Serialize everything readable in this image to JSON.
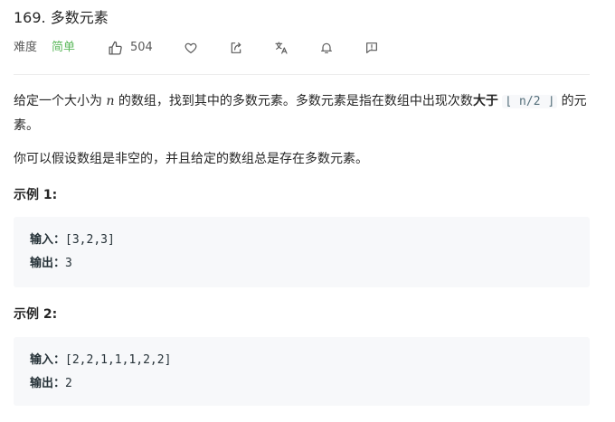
{
  "problem": {
    "title": "169. 多数元素",
    "difficulty_label": "难度",
    "difficulty_value": "简单",
    "likes": "504"
  },
  "toolbar": {
    "icons": [
      "thumbs-up-icon",
      "heart-icon",
      "share-icon",
      "translate-icon",
      "bell-icon",
      "feedback-icon"
    ]
  },
  "description": {
    "p1_part1": "给定一个大小为 ",
    "p1_var": "n",
    "p1_part2": " 的数组，找到其中的多数元素。多数元素是指在数组中出现次数",
    "p1_bold": "大于",
    "p1_code": "⌊ n/2 ⌋",
    "p1_part3": " 的元素。",
    "p2": "你可以假设数组是非空的，并且给定的数组总是存在多数元素。"
  },
  "examples": [
    {
      "heading": "示例 1:",
      "input_label": "输入：",
      "input_value": "[3,2,3]",
      "output_label": "输出：",
      "output_value": "3"
    },
    {
      "heading": "示例 2:",
      "input_label": "输入：",
      "input_value": "[2,2,1,1,1,2,2]",
      "output_label": "输出：",
      "output_value": "2"
    }
  ],
  "colors": {
    "easy": "#5cb85c",
    "code_bg": "#f7f8fa",
    "divider": "#ececec"
  }
}
